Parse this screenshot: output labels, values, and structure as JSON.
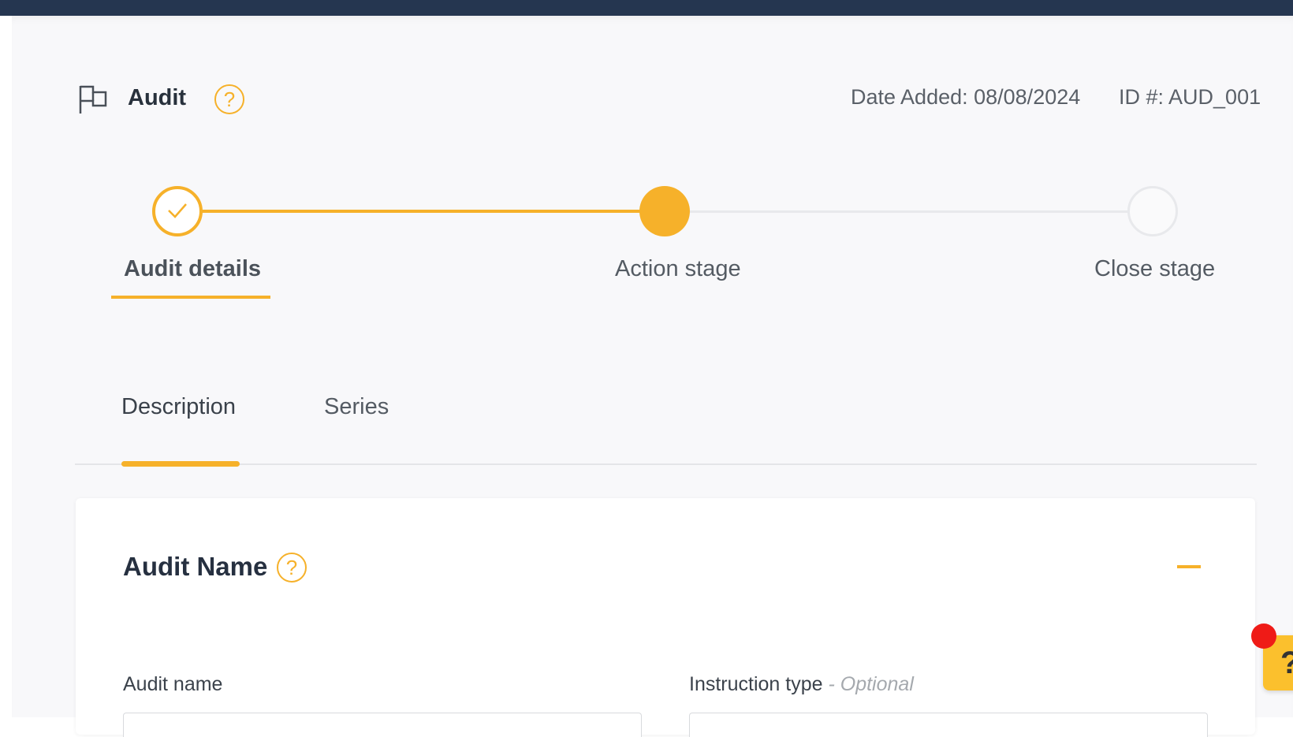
{
  "header": {
    "title": "Audit",
    "help_symbol": "?",
    "date_added": "Date Added: 08/08/2024",
    "id": "ID #: AUD_001",
    "icon": "flag-icon"
  },
  "stepper": {
    "steps": [
      {
        "label": "Audit details",
        "status": "completed",
        "icon": "check-icon"
      },
      {
        "label": "Action stage",
        "status": "current"
      },
      {
        "label": "Close stage",
        "status": "upcoming"
      }
    ],
    "accent_color": "#f6b12a"
  },
  "tabs": [
    {
      "label": "Description",
      "active": true
    },
    {
      "label": "Series",
      "active": false
    }
  ],
  "card": {
    "title": "Audit Name",
    "help_symbol": "?",
    "fields": [
      {
        "label": "Audit name",
        "optional_text": ""
      },
      {
        "label": "Instruction type",
        "optional_text": "- Optional"
      }
    ]
  },
  "help_widget": {
    "label": "?"
  },
  "colors": {
    "topbar": "#253650",
    "accent": "#f6b12a",
    "notification_dot": "#ef1b17"
  }
}
